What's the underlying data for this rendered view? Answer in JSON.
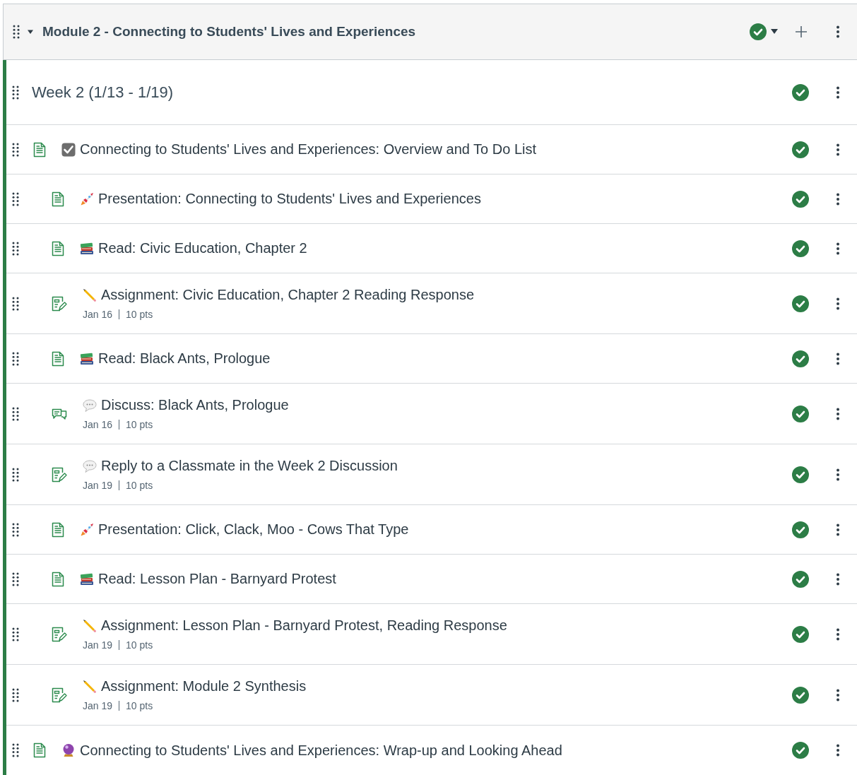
{
  "module": {
    "title": "Module 2 - Connecting to Students' Lives and Experiences",
    "expanded": true,
    "published": true
  },
  "items": [
    {
      "kind": "subheader",
      "title": "Week 2 (1/13 - 1/19)",
      "published": true,
      "indented": false
    },
    {
      "kind": "page",
      "emoji": {
        "kind": "checkbox"
      },
      "title": "Connecting to Students' Lives and Experiences: Overview and To Do List",
      "published": true,
      "indented": false
    },
    {
      "kind": "page",
      "emoji": {
        "kind": "rocket"
      },
      "title": "Presentation: Connecting to Students' Lives and Experiences",
      "published": true,
      "indented": true
    },
    {
      "kind": "page",
      "emoji": {
        "kind": "books"
      },
      "title": "Read: Civic Education, Chapter 2",
      "published": true,
      "indented": true
    },
    {
      "kind": "assignment",
      "emoji": {
        "kind": "pencil"
      },
      "title": "Assignment: Civic Education, Chapter 2 Reading Response",
      "due": "Jan 16",
      "points": "10 pts",
      "published": true,
      "indented": true
    },
    {
      "kind": "page",
      "emoji": {
        "kind": "books"
      },
      "title": "Read: Black Ants, Prologue",
      "published": true,
      "indented": true
    },
    {
      "kind": "discussion",
      "emoji": {
        "kind": "speech"
      },
      "title": "Discuss: Black Ants, Prologue",
      "due": "Jan 16",
      "points": "10 pts",
      "published": true,
      "indented": true
    },
    {
      "kind": "assignment",
      "emoji": {
        "kind": "speech"
      },
      "title": "Reply to a Classmate in the Week 2 Discussion",
      "due": "Jan 19",
      "points": "10 pts",
      "published": true,
      "indented": true
    },
    {
      "kind": "page",
      "emoji": {
        "kind": "rocket"
      },
      "title": "Presentation: Click, Clack, Moo - Cows That Type",
      "published": true,
      "indented": true
    },
    {
      "kind": "page",
      "emoji": {
        "kind": "books"
      },
      "title": "Read: Lesson Plan - Barnyard Protest",
      "published": true,
      "indented": true
    },
    {
      "kind": "assignment",
      "emoji": {
        "kind": "pencil"
      },
      "title": "Assignment: Lesson Plan - Barnyard Protest, Reading Response",
      "due": "Jan 19",
      "points": "10 pts",
      "published": true,
      "indented": true
    },
    {
      "kind": "assignment",
      "emoji": {
        "kind": "pencil"
      },
      "title": "Assignment: Module 2 Synthesis",
      "due": "Jan 19",
      "points": "10 pts",
      "published": true,
      "indented": true
    },
    {
      "kind": "page",
      "emoji": {
        "kind": "crystal-ball"
      },
      "title": "Connecting to Students' Lives and Experiences: Wrap-up and Looking Ahead",
      "published": true,
      "indented": false
    }
  ]
}
